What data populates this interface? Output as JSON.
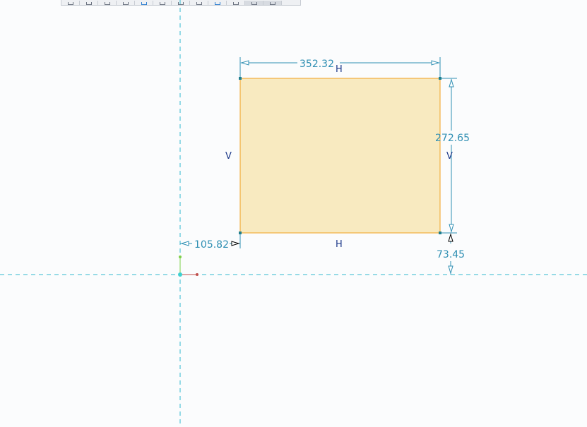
{
  "toolbar": {
    "buttons": [
      {
        "name": "undo-button-icon",
        "style": "normal"
      },
      {
        "name": "redo-button-icon",
        "style": "normal"
      },
      {
        "name": "select-button-icon",
        "style": "normal"
      },
      {
        "name": "line-button-icon",
        "style": "normal"
      },
      {
        "name": "rectangle-button-icon",
        "style": "blue"
      },
      {
        "name": "circle-button-icon",
        "style": "normal"
      },
      {
        "name": "arc-button-icon",
        "style": "normal"
      },
      {
        "name": "dimension-button-icon",
        "style": "normal"
      },
      {
        "name": "constraint-button-icon",
        "style": "blue"
      },
      {
        "name": "trim-button-icon",
        "style": "normal"
      },
      {
        "name": "mirror-button-icon",
        "style": "active"
      },
      {
        "name": "display-button-icon",
        "style": "active"
      }
    ]
  },
  "sketch": {
    "colors": {
      "rectangle_fill": "#f8eac0",
      "rectangle_edge": "#f0a020",
      "dimension": "#2f8fb3",
      "centerline": "#32b7d0",
      "constraint_label": "#1e3a8a",
      "vertex": "#1f7f8f"
    },
    "dimensions": {
      "width": "352.32",
      "height": "272.65",
      "horizontal_offset": "105.82",
      "vertical_offset": "73.45"
    },
    "constraints": {
      "top": "H",
      "bottom": "H",
      "left": "V",
      "right": "V"
    }
  }
}
